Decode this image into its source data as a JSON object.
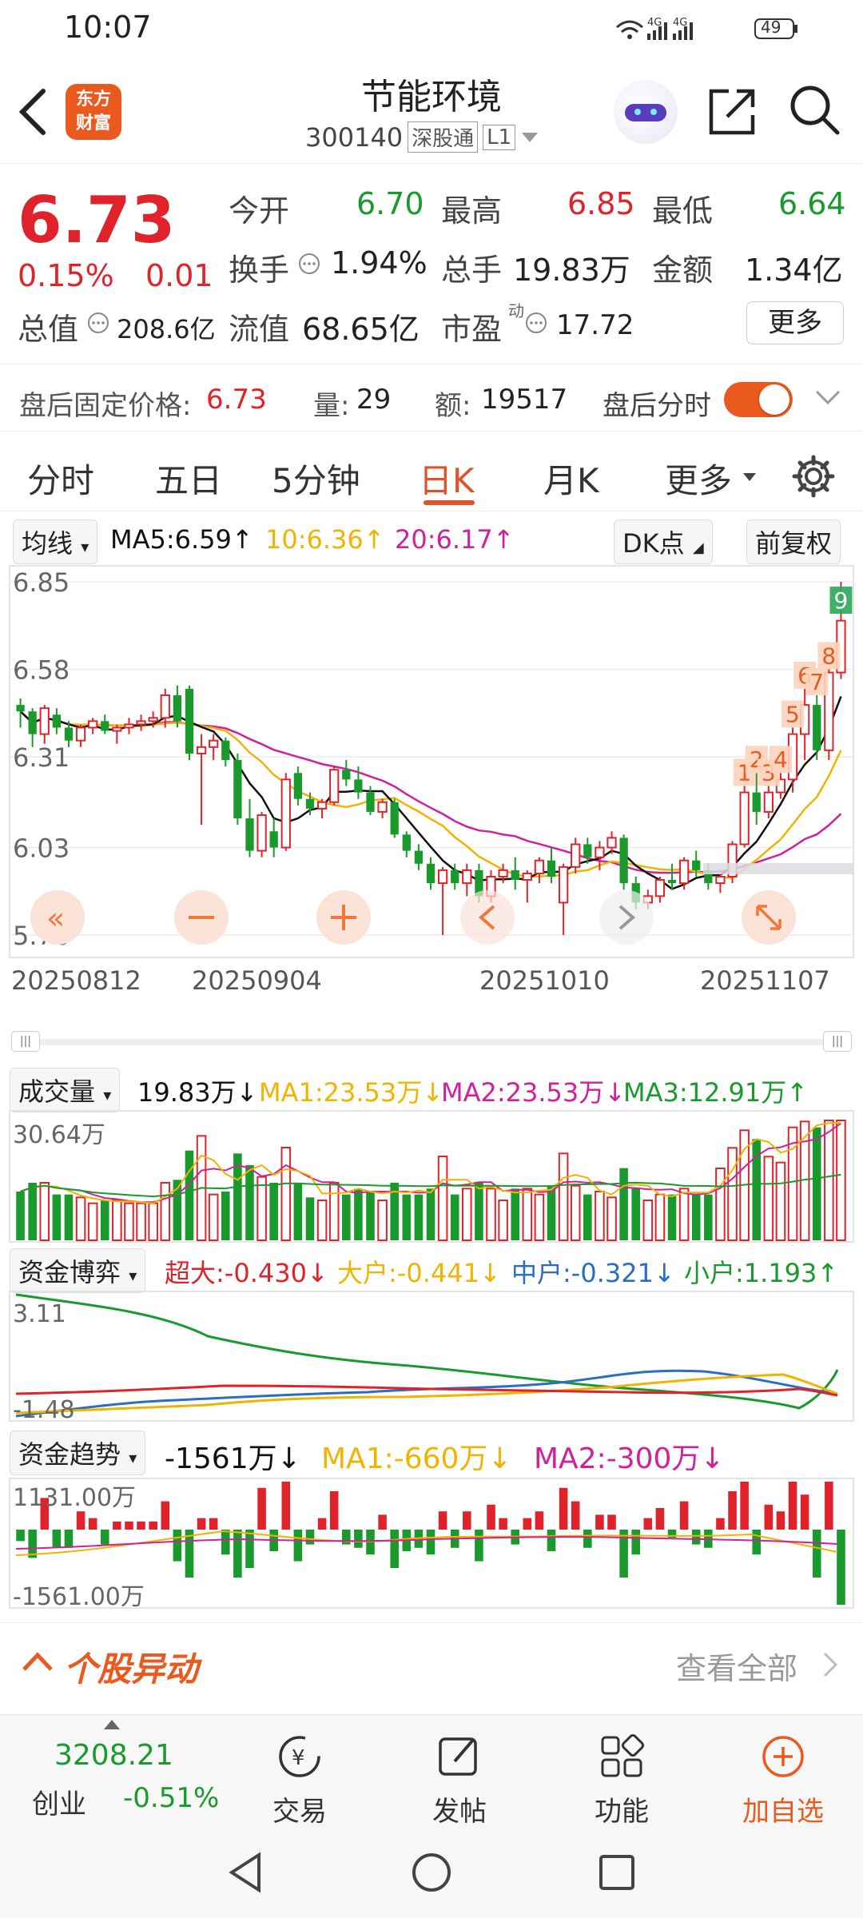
{
  "status": {
    "time": "10:07",
    "battery": "49",
    "net1": "4G",
    "net2": "4G"
  },
  "header": {
    "app_logo_line1": "东方",
    "app_logo_line2": "财富",
    "stock_name": "节能环境",
    "stock_code": "300140",
    "connect_tag": "深股通",
    "level_tag": "L1"
  },
  "quote": {
    "price": "6.73",
    "change_pct": "0.15%",
    "change_amt": "0.01",
    "open_label": "今开",
    "open": "6.70",
    "high_label": "最高",
    "high": "6.85",
    "low_label": "最低",
    "low": "6.64",
    "turnover_label": "换手",
    "turnover": "1.94%",
    "volume_label": "总手",
    "volume": "19.83万",
    "amount_label": "金额",
    "amount": "1.34亿",
    "mktcap_label": "总值",
    "mktcap": "208.6亿",
    "float_label": "流值",
    "float": "68.65亿",
    "pe_label": "市盈",
    "pe_sup": "动",
    "pe": "17.72",
    "more_button": "更多"
  },
  "after_hours": {
    "price_label": "盘后固定价格:",
    "price": "6.73",
    "qty_label": "量:",
    "qty": "29",
    "amt_label": "额:",
    "amt": "19517",
    "toggle_label": "盘后分时",
    "toggle_on": true
  },
  "tabs": [
    "分时",
    "五日",
    "5分钟",
    "日K",
    "月K",
    "更多"
  ],
  "active_tab": "日K",
  "kline_header": {
    "indicator": "均线",
    "ma5": "MA5:6.59↑",
    "ma10": "10:6.36↑",
    "ma20": "20:6.17↑",
    "dk_button": "DK点",
    "adjust_button": "前复权"
  },
  "chart_data": [
    {
      "type": "candlestick",
      "title": "日K",
      "y_ticks": [
        "6.85",
        "6.58",
        "6.31",
        "6.03",
        "5.76"
      ],
      "x_ticks": [
        "20250812",
        "20250904",
        "20251010",
        "20251107"
      ],
      "ylim": [
        5.76,
        6.85
      ],
      "ma_colors": {
        "ma5": "#111111",
        "ma10": "#f0b400",
        "ma20": "#d0209a"
      },
      "signal_labels": [
        "1",
        "2",
        "3",
        "4",
        "5",
        "6",
        "7",
        "8",
        "9"
      ],
      "candles": [
        [
          6.47,
          6.49,
          6.4,
          6.45
        ],
        [
          6.45,
          6.46,
          6.34,
          6.38
        ],
        [
          6.38,
          6.47,
          6.35,
          6.46
        ],
        [
          6.44,
          6.46,
          6.38,
          6.4
        ],
        [
          6.4,
          6.42,
          6.34,
          6.36
        ],
        [
          6.36,
          6.41,
          6.34,
          6.4
        ],
        [
          6.4,
          6.43,
          6.38,
          6.42
        ],
        [
          6.42,
          6.44,
          6.38,
          6.39
        ],
        [
          6.39,
          6.41,
          6.35,
          6.4
        ],
        [
          6.4,
          6.43,
          6.38,
          6.41
        ],
        [
          6.41,
          6.44,
          6.39,
          6.42
        ],
        [
          6.42,
          6.45,
          6.4,
          6.43
        ],
        [
          6.43,
          6.52,
          6.4,
          6.5
        ],
        [
          6.5,
          6.53,
          6.4,
          6.42
        ],
        [
          6.52,
          6.53,
          6.3,
          6.32
        ],
        [
          6.32,
          6.38,
          6.1,
          6.34
        ],
        [
          6.34,
          6.38,
          6.3,
          6.36
        ],
        [
          6.36,
          6.37,
          6.28,
          6.3
        ],
        [
          6.3,
          6.32,
          6.1,
          6.12
        ],
        [
          6.12,
          6.18,
          6.0,
          6.02
        ],
        [
          6.02,
          6.14,
          6.0,
          6.13
        ],
        [
          6.08,
          6.12,
          6.0,
          6.03
        ],
        [
          6.03,
          6.26,
          6.02,
          6.24
        ],
        [
          6.26,
          6.28,
          6.16,
          6.18
        ],
        [
          6.18,
          6.2,
          6.13,
          6.15
        ],
        [
          6.15,
          6.18,
          6.12,
          6.17
        ],
        [
          6.17,
          6.28,
          6.16,
          6.27
        ],
        [
          6.27,
          6.3,
          6.22,
          6.24
        ],
        [
          6.24,
          6.28,
          6.18,
          6.2
        ],
        [
          6.2,
          6.22,
          6.13,
          6.14
        ],
        [
          6.14,
          6.18,
          6.12,
          6.17
        ],
        [
          6.17,
          6.18,
          6.06,
          6.07
        ],
        [
          6.07,
          6.08,
          6.0,
          6.02
        ],
        [
          6.02,
          6.04,
          5.96,
          5.98
        ],
        [
          5.98,
          6.0,
          5.9,
          5.92
        ],
        [
          5.92,
          5.97,
          5.76,
          5.96
        ],
        [
          5.96,
          5.98,
          5.9,
          5.92
        ],
        [
          5.92,
          5.98,
          5.88,
          5.96
        ],
        [
          5.96,
          5.98,
          5.86,
          5.88
        ],
        [
          5.88,
          5.96,
          5.86,
          5.94
        ],
        [
          5.94,
          5.98,
          5.92,
          5.96
        ],
        [
          5.96,
          6.0,
          5.9,
          5.93
        ],
        [
          5.93,
          5.96,
          5.86,
          5.95
        ],
        [
          5.95,
          6.0,
          5.92,
          5.99
        ],
        [
          5.99,
          6.03,
          5.92,
          5.94
        ],
        [
          5.86,
          5.98,
          5.76,
          5.97
        ],
        [
          5.97,
          6.06,
          5.95,
          6.04
        ],
        [
          6.04,
          6.06,
          5.98,
          6.0
        ],
        [
          6.0,
          6.05,
          5.96,
          6.03
        ],
        [
          6.03,
          6.08,
          6.01,
          6.06
        ],
        [
          6.06,
          6.07,
          5.9,
          5.92
        ],
        [
          5.92,
          5.94,
          5.84,
          5.86
        ],
        [
          5.86,
          5.9,
          5.84,
          5.88
        ],
        [
          5.88,
          5.94,
          5.86,
          5.93
        ],
        [
          5.93,
          5.98,
          5.9,
          5.92
        ],
        [
          5.92,
          6.0,
          5.9,
          5.99
        ],
        [
          5.99,
          6.02,
          5.94,
          5.96
        ],
        [
          5.96,
          5.98,
          5.9,
          5.92
        ],
        [
          5.92,
          5.95,
          5.89,
          5.94
        ],
        [
          5.94,
          6.05,
          5.92,
          6.04
        ],
        [
          6.04,
          6.22,
          6.03,
          6.2
        ],
        [
          6.2,
          6.26,
          6.1,
          6.14
        ],
        [
          6.14,
          6.22,
          6.12,
          6.2
        ],
        [
          6.2,
          6.26,
          6.18,
          6.24
        ],
        [
          6.24,
          6.4,
          6.2,
          6.38
        ],
        [
          6.38,
          6.52,
          6.3,
          6.47
        ],
        [
          6.47,
          6.5,
          6.3,
          6.33
        ],
        [
          6.33,
          6.58,
          6.3,
          6.57
        ],
        [
          6.57,
          6.85,
          6.55,
          6.73
        ]
      ]
    },
    {
      "type": "bar",
      "title": "成交量",
      "value": "19.83万↓",
      "ma1": "MA1:23.53万↓",
      "ma2": "MA2:23.53万↓",
      "ma3": "MA3:12.91万↑",
      "y_tick": "30.64万"
    },
    {
      "type": "line",
      "title": "资金博弈",
      "super": "超大:-0.430↓",
      "big": "大户:-0.441↓",
      "mid": "中户:-0.321↓",
      "small": "小户:1.193↑",
      "y_ticks": [
        "3.11",
        "-1.48"
      ]
    },
    {
      "type": "bar",
      "title": "资金趋势",
      "value": "-1561万↓",
      "ma1": "MA1:-660万↓",
      "ma2": "MA2:-300万↓",
      "y_ticks": [
        "1131.00万",
        "-1561.00万"
      ]
    }
  ],
  "anomaly": {
    "title": "个股异动",
    "view_all": "查看全部"
  },
  "bottom_nav": {
    "index_value": "3208.21",
    "index_name": "创业",
    "index_change": "-0.51%",
    "trade": "交易",
    "post": "发帖",
    "features": "功能",
    "add_watch": "加自选"
  }
}
